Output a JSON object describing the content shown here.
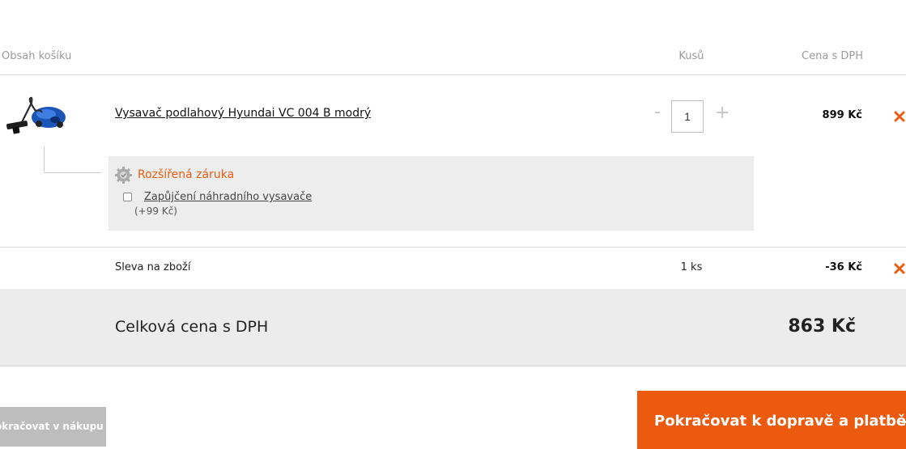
{
  "cart": {
    "header": {
      "content_label": "Obsah košíku",
      "qty_label": "Kusů",
      "price_label": "Cena s DPH"
    },
    "item": {
      "name": "Vysavač podlahový Hyundai VC 004 B modrý",
      "quantity": "1",
      "minus": "-",
      "plus": "+",
      "price": "899 Kč",
      "image_icon": "vacuum-cleaner-product-image"
    },
    "warranty": {
      "title": "Rozšířená záruka",
      "icon": "gear-badge-icon",
      "option_label": "Zapůjčení náhradního vysavače",
      "option_price": "(+99 Kč)",
      "option_checked": false
    },
    "discount": {
      "label": "Sleva na zboží",
      "quantity": "1 ks",
      "amount": "-36 Kč"
    },
    "total": {
      "label": "Celková cena s DPH",
      "value": "863 Kč"
    }
  },
  "actions": {
    "continue_shopping": "okračovat v nákupu",
    "proceed": "Pokračovat k dopravě a platbě",
    "proceed_arrow": "→"
  },
  "colors": {
    "accent": "#ec5a0f",
    "remove": "#e85d12",
    "total_band": "#ececec",
    "warranty_box": "#ededed"
  }
}
